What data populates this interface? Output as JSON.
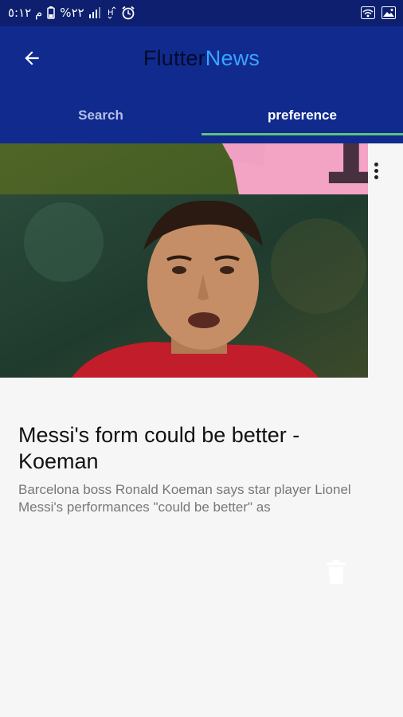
{
  "status_bar": {
    "time": "م ٥:١٢",
    "battery": "%٢٢",
    "icons": [
      "battery-icon",
      "signal-icon",
      "data-h-icon",
      "alarm-icon",
      "wifi-icon",
      "image-icon"
    ]
  },
  "app_bar": {
    "title_part1": "Flutter",
    "title_part2": "News",
    "colors": {
      "background": "#102a8e",
      "accent": "#3aa3ff",
      "indicator": "#5fc27c"
    }
  },
  "tabs": [
    {
      "label": "Search",
      "active": false
    },
    {
      "label": "preference",
      "active": true
    }
  ],
  "articles": [
    {
      "title": "Messi's form could be better - Koeman",
      "description": "Barcelona boss Ronald Koeman says star player Lionel Messi's performances \"could be better\" as"
    }
  ]
}
